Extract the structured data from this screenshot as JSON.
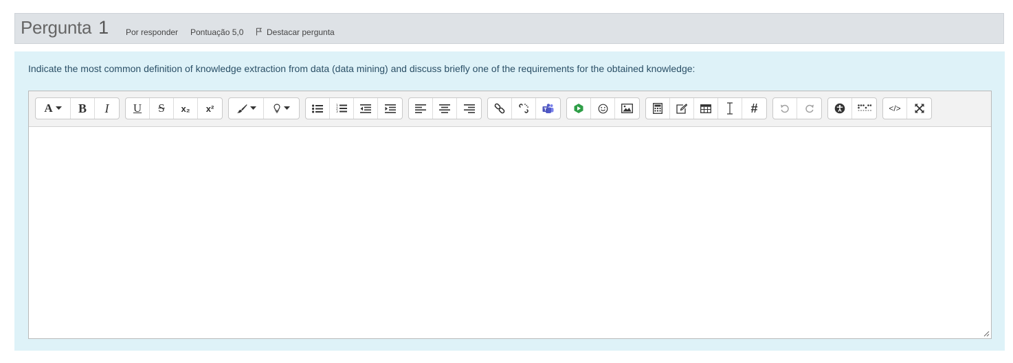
{
  "question": {
    "label": "Pergunta",
    "number": "1",
    "status": "Por responder",
    "score": "Pontuação 5,0",
    "flag_label": "Destacar pergunta",
    "prompt": "Indicate the most common definition of knowledge extraction from data (data mining) and discuss briefly one of the requirements for the obtained knowledge:"
  },
  "toolbar": {
    "font_label": "A",
    "bold_label": "B",
    "italic_label": "I",
    "underline_label": "U",
    "strike_label": "S",
    "subscript_label": "x₂",
    "superscript_label": "x²",
    "special_char_label": "#",
    "html_label": "</>"
  },
  "editor": {
    "value": ""
  },
  "colors": {
    "accent_green": "#2e9e47",
    "teams_purple": "#5059c9"
  }
}
